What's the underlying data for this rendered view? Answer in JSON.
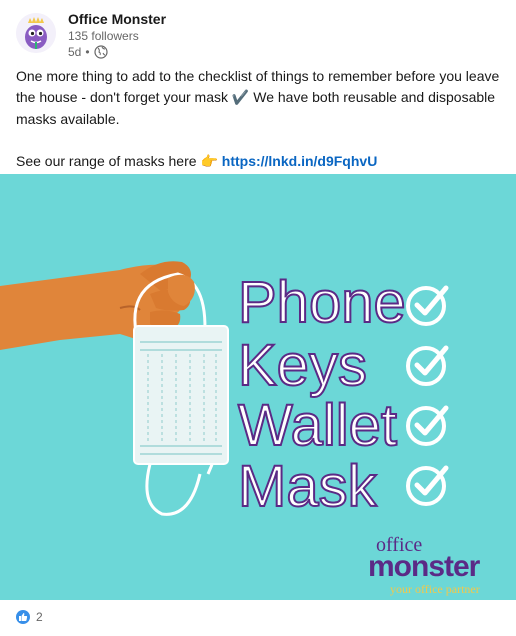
{
  "author": {
    "name": "Office Monster",
    "followers": "135 followers",
    "age": "5d",
    "separator": "•",
    "visibility_icon": "globe-icon",
    "avatar_icon": "office-monster-mascot-icon"
  },
  "post": {
    "line1": "One more thing to add to the checklist of things to remember before you leave the house - don't forget your mask",
    "check_emoji": "✔️",
    "line2": "We have both reusable and disposable masks available.",
    "line3": "See our range of masks here",
    "pointing_emoji": "👉",
    "link": "https://lnkd.in/d9FqhvU"
  },
  "image": {
    "background": "#6cd7d7",
    "words": [
      "Phone",
      "Keys",
      "Wallet",
      "Mask"
    ],
    "check_icon": "check-circle-icon",
    "logo": {
      "top": "office",
      "main": "monster",
      "tagline": "your office partner"
    }
  },
  "reactions": {
    "icon": "like-icon",
    "count": "2"
  },
  "colors": {
    "purple": "#5b2a86",
    "link": "#0a66c2",
    "skin": "#e0853a",
    "yellow": "#f2c84b"
  }
}
